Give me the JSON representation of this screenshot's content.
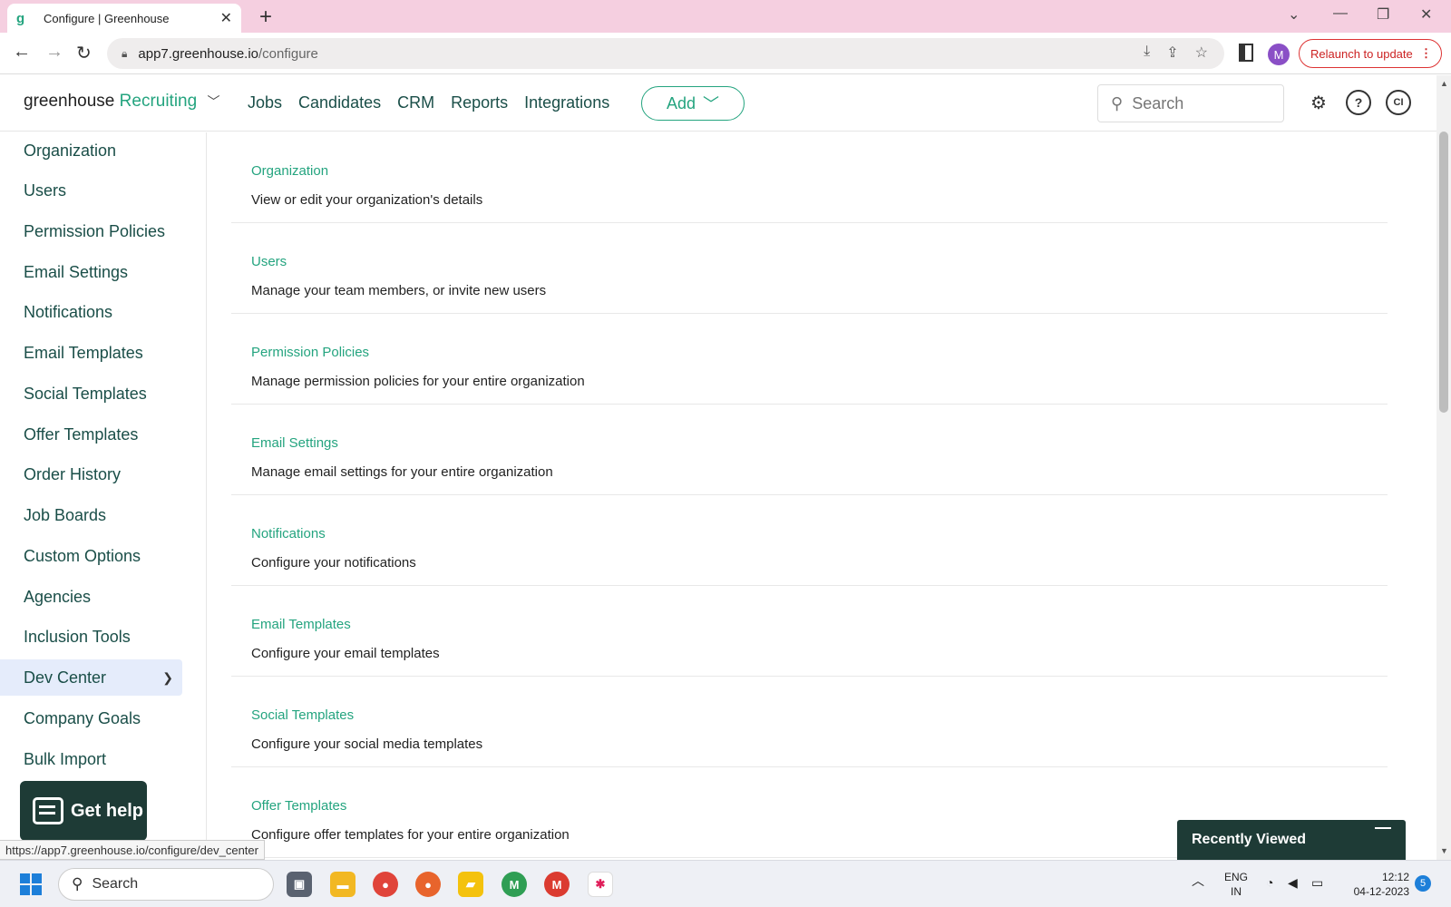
{
  "browser": {
    "tab_title": "Configure | Greenhouse",
    "tab_favicon": "g",
    "url_host": "app7.greenhouse.io",
    "url_path": "/configure",
    "profile_initial": "M",
    "relaunch_label": "Relaunch to update",
    "status_url": "https://app7.greenhouse.io/configure/dev_center"
  },
  "header": {
    "logo_main": "greenhouse",
    "logo_product": "Recruiting",
    "nav": [
      "Jobs",
      "Candidates",
      "CRM",
      "Reports",
      "Integrations"
    ],
    "add_label": "Add",
    "search_placeholder": "Search",
    "avatar_initials": "CI"
  },
  "sidebar": {
    "items": [
      {
        "label": "Organization"
      },
      {
        "label": "Users"
      },
      {
        "label": "Permission Policies"
      },
      {
        "label": "Email Settings"
      },
      {
        "label": "Notifications"
      },
      {
        "label": "Email Templates"
      },
      {
        "label": "Social Templates"
      },
      {
        "label": "Offer Templates"
      },
      {
        "label": "Order History"
      },
      {
        "label": "Job Boards"
      },
      {
        "label": "Custom Options"
      },
      {
        "label": "Agencies"
      },
      {
        "label": "Inclusion Tools"
      },
      {
        "label": "Dev Center"
      },
      {
        "label": "Company Goals"
      },
      {
        "label": "Bulk Import"
      }
    ],
    "active_item": "Dev Center"
  },
  "sections": [
    {
      "title": "Organization",
      "description": "View or edit your organization's details"
    },
    {
      "title": "Users",
      "description": "Manage your team members, or invite new users"
    },
    {
      "title": "Permission Policies",
      "description": "Manage permission policies for your entire organization"
    },
    {
      "title": "Email Settings",
      "description": "Manage email settings for your entire organization"
    },
    {
      "title": "Notifications",
      "description": "Configure your notifications"
    },
    {
      "title": "Email Templates",
      "description": "Configure your email templates"
    },
    {
      "title": "Social Templates",
      "description": "Configure your social media templates"
    },
    {
      "title": "Offer Templates",
      "description": "Configure offer templates for your entire organization"
    }
  ],
  "widgets": {
    "get_help_label": "Get help",
    "recently_viewed_label": "Recently Viewed"
  },
  "taskbar": {
    "search_label": "Search",
    "lang_line1": "ENG",
    "lang_line2": "IN",
    "time": "12:12",
    "date": "04-12-2023",
    "notification_count": "5",
    "chrome_badge_1": "M",
    "chrome_badge_2": "M"
  },
  "colors": {
    "brand_green": "#24a47f",
    "dark_green": "#1e3b36",
    "tab_strip": "#f5cfe0",
    "active_item_bg": "#e5ecfb"
  }
}
